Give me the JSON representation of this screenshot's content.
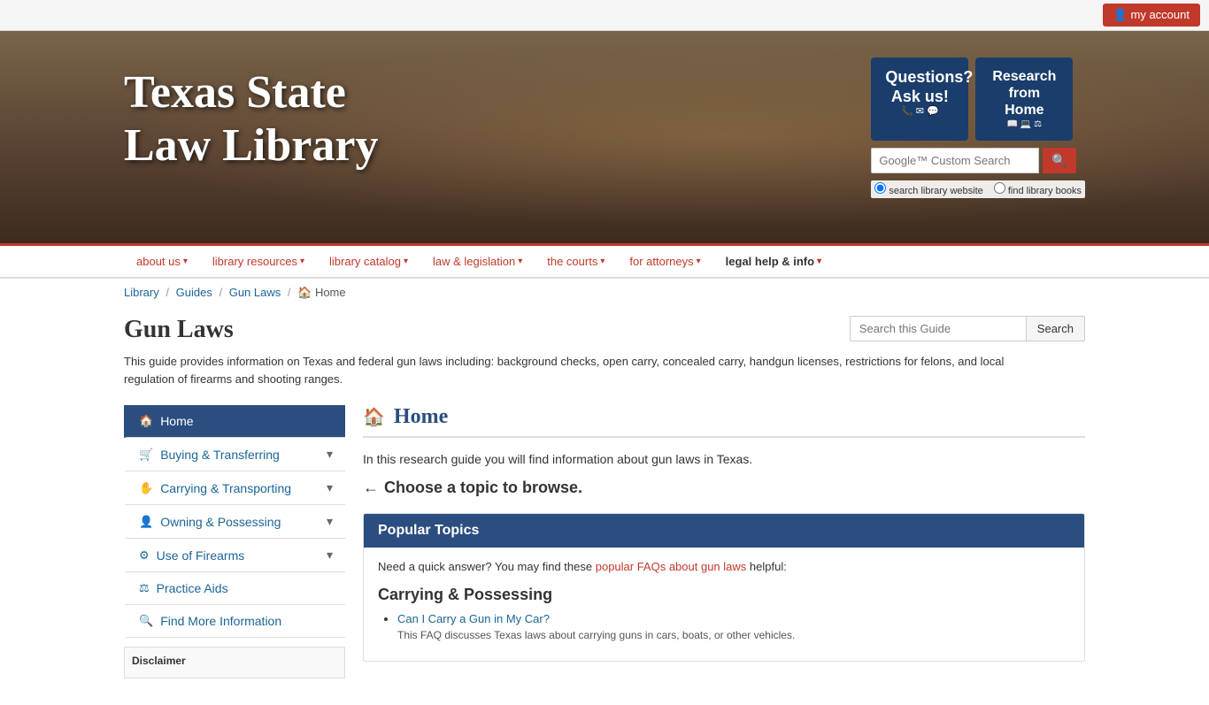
{
  "topbar": {
    "my_account_label": "my account"
  },
  "header": {
    "title_line1": "Texas State",
    "title_line2": "Law Library",
    "ask_us_label": "Questions?\nAsk us!",
    "research_label": "Research\nfrom Home",
    "search_placeholder": "Google™ Custom Search",
    "search_radio_website": "search library website",
    "search_radio_books": "find library books"
  },
  "nav": {
    "items": [
      {
        "label": "about us",
        "has_arrow": true
      },
      {
        "label": "library resources",
        "has_arrow": true
      },
      {
        "label": "library catalog",
        "has_arrow": true
      },
      {
        "label": "law & legislation",
        "has_arrow": true
      },
      {
        "label": "the courts",
        "has_arrow": true
      },
      {
        "label": "for attorneys",
        "has_arrow": true
      },
      {
        "label": "legal help & info",
        "has_arrow": true,
        "dark": true
      }
    ]
  },
  "breadcrumb": {
    "items": [
      {
        "label": "Library",
        "href": "#"
      },
      {
        "label": "Guides",
        "href": "#"
      },
      {
        "label": "Gun Laws",
        "href": "#"
      }
    ],
    "current": "Home"
  },
  "guide_search": {
    "placeholder": "Search this Guide",
    "button_label": "Search"
  },
  "page": {
    "title": "Gun Laws",
    "description": "This guide provides information on Texas and federal gun laws including: background checks, open carry, concealed carry, handgun licenses, restrictions for felons, and local regulation of firearms and shooting ranges."
  },
  "sidebar": {
    "items": [
      {
        "label": "Home",
        "icon": "🏠",
        "active": true,
        "has_expand": false
      },
      {
        "label": "Buying & Transferring",
        "icon": "🛒",
        "active": false,
        "has_expand": true
      },
      {
        "label": "Carrying & Transporting",
        "icon": "✋",
        "active": false,
        "has_expand": true
      },
      {
        "label": "Owning & Possessing",
        "icon": "👤",
        "active": false,
        "has_expand": true
      },
      {
        "label": "Use of Firearms",
        "icon": "⚙",
        "active": false,
        "has_expand": true
      },
      {
        "label": "Practice Aids",
        "icon": "⚖",
        "active": false,
        "has_expand": false
      },
      {
        "label": "Find More Information",
        "icon": "🔍",
        "active": false,
        "has_expand": false
      }
    ],
    "disclaimer_title": "Disclaimer"
  },
  "main": {
    "section_title": "Home",
    "intro_text": "In this research guide you will find information about gun laws in Texas.",
    "choose_topic": "Choose a topic to browse.",
    "popular_topics_header": "Popular Topics",
    "popular_intro_text": "Need a quick answer? You may find these",
    "popular_intro_link": "popular FAQs about gun laws",
    "popular_intro_suffix": "helpful:",
    "carrying_section": "Carrying & Possessing",
    "faq_items": [
      {
        "link": "Can I Carry a Gun in My Car?",
        "desc": "This FAQ discusses Texas laws about carrying guns in cars, boats, or other vehicles."
      }
    ]
  }
}
